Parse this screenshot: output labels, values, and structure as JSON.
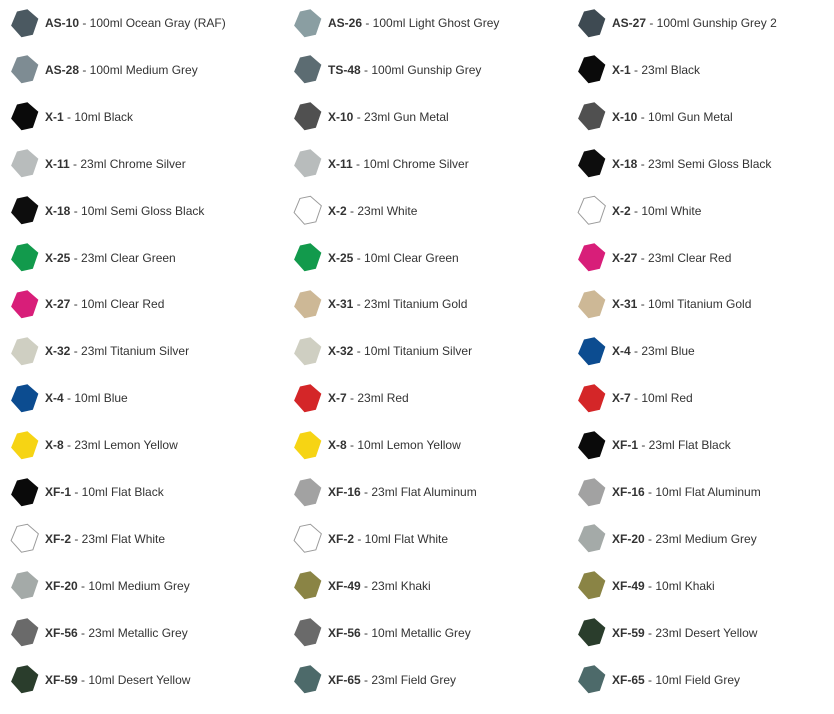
{
  "columns": 3,
  "items": [
    {
      "code": "AS-10",
      "desc": " - 100ml Ocean Gray (RAF)",
      "color": "#4b5961"
    },
    {
      "code": "AS-26",
      "desc": " - 100ml Light Ghost Grey",
      "color": "#8a9ea2"
    },
    {
      "code": "AS-27",
      "desc": " - 100ml Gunship Grey 2",
      "color": "#3e4a52"
    },
    {
      "code": "AS-28",
      "desc": " - 100ml Medium Grey",
      "color": "#7e8c93"
    },
    {
      "code": "TS-48",
      "desc": " - 100ml Gunship Grey",
      "color": "#5c6c72"
    },
    {
      "code": "X-1",
      "desc": " - 23ml Black",
      "color": "#0a0a0a"
    },
    {
      "code": "X-1",
      "desc": " - 10ml Black",
      "color": "#0a0a0a"
    },
    {
      "code": "X-10",
      "desc": " - 23ml Gun Metal",
      "color": "#505050"
    },
    {
      "code": "X-10",
      "desc": " - 10ml Gun Metal",
      "color": "#505050"
    },
    {
      "code": "X-11",
      "desc": " - 23ml Chrome Silver",
      "color": "#b8bcbc"
    },
    {
      "code": "X-11",
      "desc": " - 10ml Chrome Silver",
      "color": "#b8bcbc"
    },
    {
      "code": "X-18",
      "desc": " - 23ml Semi Gloss Black",
      "color": "#0d0d0d"
    },
    {
      "code": "X-18",
      "desc": " - 10ml Semi Gloss Black",
      "color": "#0d0d0d"
    },
    {
      "code": "X-2",
      "desc": " - 23ml White",
      "color": "#ffffff"
    },
    {
      "code": "X-2",
      "desc": " - 10ml White",
      "color": "#ffffff"
    },
    {
      "code": "X-25",
      "desc": " - 23ml Clear Green",
      "color": "#129a4c"
    },
    {
      "code": "X-25",
      "desc": " - 10ml Clear Green",
      "color": "#129a4c"
    },
    {
      "code": "X-27",
      "desc": " - 23ml Clear Red",
      "color": "#d81e79"
    },
    {
      "code": "X-27",
      "desc": " - 10ml Clear Red",
      "color": "#d81e79"
    },
    {
      "code": "X-31",
      "desc": " - 23ml Titanium Gold",
      "color": "#cdb896"
    },
    {
      "code": "X-31",
      "desc": " - 10ml Titanium Gold",
      "color": "#cdb896"
    },
    {
      "code": "X-32",
      "desc": " - 23ml Titanium Silver",
      "color": "#cfcfc2"
    },
    {
      "code": "X-32",
      "desc": " - 10ml Titanium Silver",
      "color": "#cfcfc2"
    },
    {
      "code": "X-4",
      "desc": " - 23ml Blue",
      "color": "#0c4c90"
    },
    {
      "code": "X-4",
      "desc": " - 10ml Blue",
      "color": "#0c4c90"
    },
    {
      "code": "X-7",
      "desc": " - 23ml Red",
      "color": "#d42628"
    },
    {
      "code": "X-7",
      "desc": " - 10ml Red",
      "color": "#d42628"
    },
    {
      "code": "X-8",
      "desc": " - 23ml Lemon Yellow",
      "color": "#f6d414"
    },
    {
      "code": "X-8",
      "desc": " - 10ml Lemon Yellow",
      "color": "#f6d414"
    },
    {
      "code": "XF-1",
      "desc": " - 23ml Flat Black",
      "color": "#0a0a0a"
    },
    {
      "code": "XF-1",
      "desc": " - 10ml Flat Black",
      "color": "#0a0a0a"
    },
    {
      "code": "XF-16",
      "desc": " - 23ml Flat Aluminum",
      "color": "#a2a2a2"
    },
    {
      "code": "XF-16",
      "desc": " - 10ml Flat Aluminum",
      "color": "#a2a2a2"
    },
    {
      "code": "XF-2",
      "desc": " - 23ml Flat White",
      "color": "#ffffff"
    },
    {
      "code": "XF-2",
      "desc": " - 10ml Flat White",
      "color": "#ffffff"
    },
    {
      "code": "XF-20",
      "desc": " - 23ml Medium Grey",
      "color": "#a4aaa8"
    },
    {
      "code": "XF-20",
      "desc": " - 10ml Medium Grey",
      "color": "#a4aaa8"
    },
    {
      "code": "XF-49",
      "desc": " - 23ml Khaki",
      "color": "#8a8445"
    },
    {
      "code": "XF-49",
      "desc": " - 10ml Khaki",
      "color": "#8a8445"
    },
    {
      "code": "XF-56",
      "desc": " - 23ml Metallic Grey",
      "color": "#6a6a6a"
    },
    {
      "code": "XF-56",
      "desc": " - 10ml Metallic Grey",
      "color": "#6a6a6a"
    },
    {
      "code": "XF-59",
      "desc": " - 23ml Desert Yellow",
      "color": "#2a3d2c"
    },
    {
      "code": "XF-59",
      "desc": " - 10ml Desert Yellow",
      "color": "#2a3d2c"
    },
    {
      "code": "XF-65",
      "desc": " - 23ml Field Grey",
      "color": "#4d6a6a"
    },
    {
      "code": "XF-65",
      "desc": " - 10ml Field Grey",
      "color": "#4d6a6a"
    }
  ]
}
